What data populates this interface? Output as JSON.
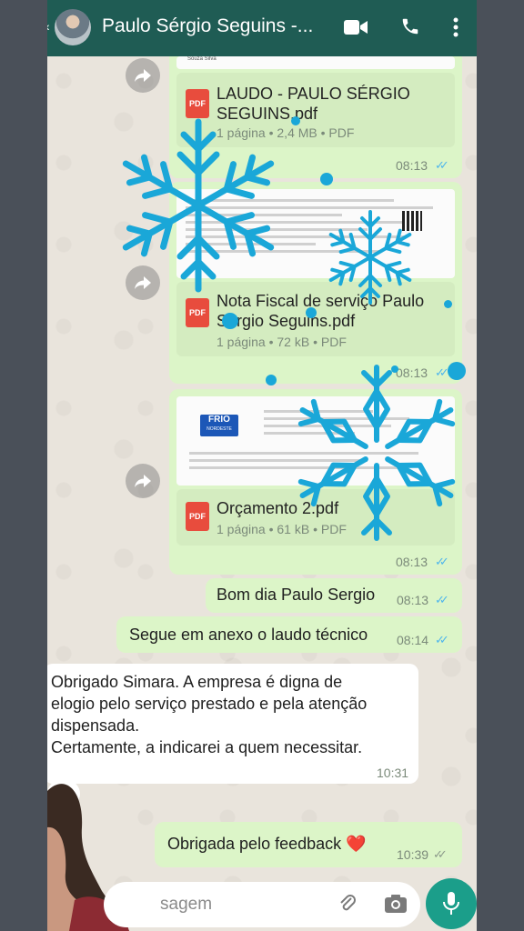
{
  "header": {
    "title": "Paulo Sérgio Seguins -...",
    "icons": [
      "video-call-icon",
      "phone-icon",
      "more-vert-icon"
    ]
  },
  "messages": {
    "doc1": {
      "name_line1": "LAUDO - PAULO SÉRGIO",
      "name_line2": "SEGUINS.pdf",
      "meta": "1 página • 2,4 MB • PDF",
      "time": "08:13",
      "preview_top": "Souza Silva"
    },
    "doc2": {
      "name_line1": "Nota Fiscal de serviço Paulo",
      "name_line2": "Sérgio Seguins.pdf",
      "meta": "1 página • 72 kB • PDF",
      "time": "08:13"
    },
    "doc3": {
      "name": "Orçamento 2.pdf",
      "meta": "1 página • 61 kB • PDF",
      "time": "08:13",
      "logo_text": "FRIO",
      "logo_sub": "NORDESTE"
    },
    "text1": {
      "text": "Bom dia Paulo Sergio",
      "time": "08:13"
    },
    "text2": {
      "text": "Segue em anexo o laudo técnico",
      "time": "08:14"
    },
    "incoming": {
      "line1": "Obrigado Simara. A empresa é digna de",
      "line2": "elogio pelo serviço prestado e pela atenção",
      "line3": "dispensada.",
      "line4": "Certamente, a indicarei a quem necessitar.",
      "time": "10:31",
      "reaction": "❤️"
    },
    "text3": {
      "text": "Obrigada pelo feedback ❤️",
      "time": "10:39"
    }
  },
  "composer": {
    "placeholder": "Mensagem",
    "visible_text": "sagem"
  },
  "pdf_badge": "PDF",
  "colors": {
    "header": "#1f5c54",
    "outgoing": "#dcf5c8",
    "read_ticks": "#4fb6ec",
    "snowflake": "#1aa7d8",
    "mic": "#1b9e8a"
  }
}
